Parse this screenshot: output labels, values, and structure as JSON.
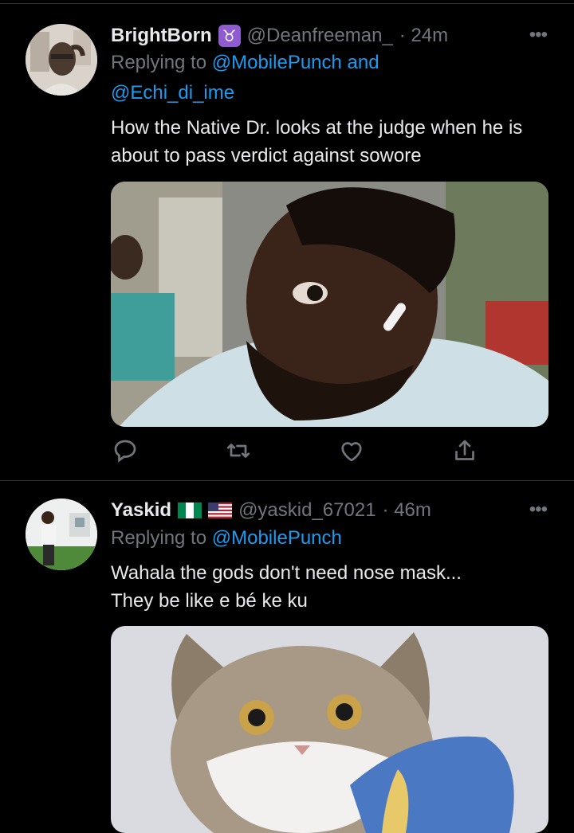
{
  "tweets": [
    {
      "name": "BrightBorn",
      "badge": "♉",
      "handle": "@Deanfreeman_",
      "time": "· 24m",
      "reply_prefix": "Replying to",
      "reply_line1_link": "@MobilePunch",
      "reply_and": "and",
      "reply_line2_link": "@Echi_di_ime",
      "text": "How the Native Dr. looks at the judge when he is about to pass verdict against sowore",
      "more": "•••",
      "actions": [
        "reply-icon",
        "retweet-icon",
        "like-icon",
        "share-icon"
      ]
    },
    {
      "name": "Yaskid",
      "flags": [
        "nigeria-flag",
        "usa-flag"
      ],
      "handle": "@yaskid_67021",
      "time": "· 46m",
      "reply_prefix": "Replying to",
      "reply_link": "@MobilePunch",
      "text_line1": "Wahala the gods don't need nose mask...",
      "text_line2": "They be like e bé ke ku",
      "more": "•••"
    }
  ],
  "colors": {
    "background": "#000000",
    "link": "#1d9bf0",
    "muted": "#71767b",
    "text": "#e7e9ea"
  }
}
